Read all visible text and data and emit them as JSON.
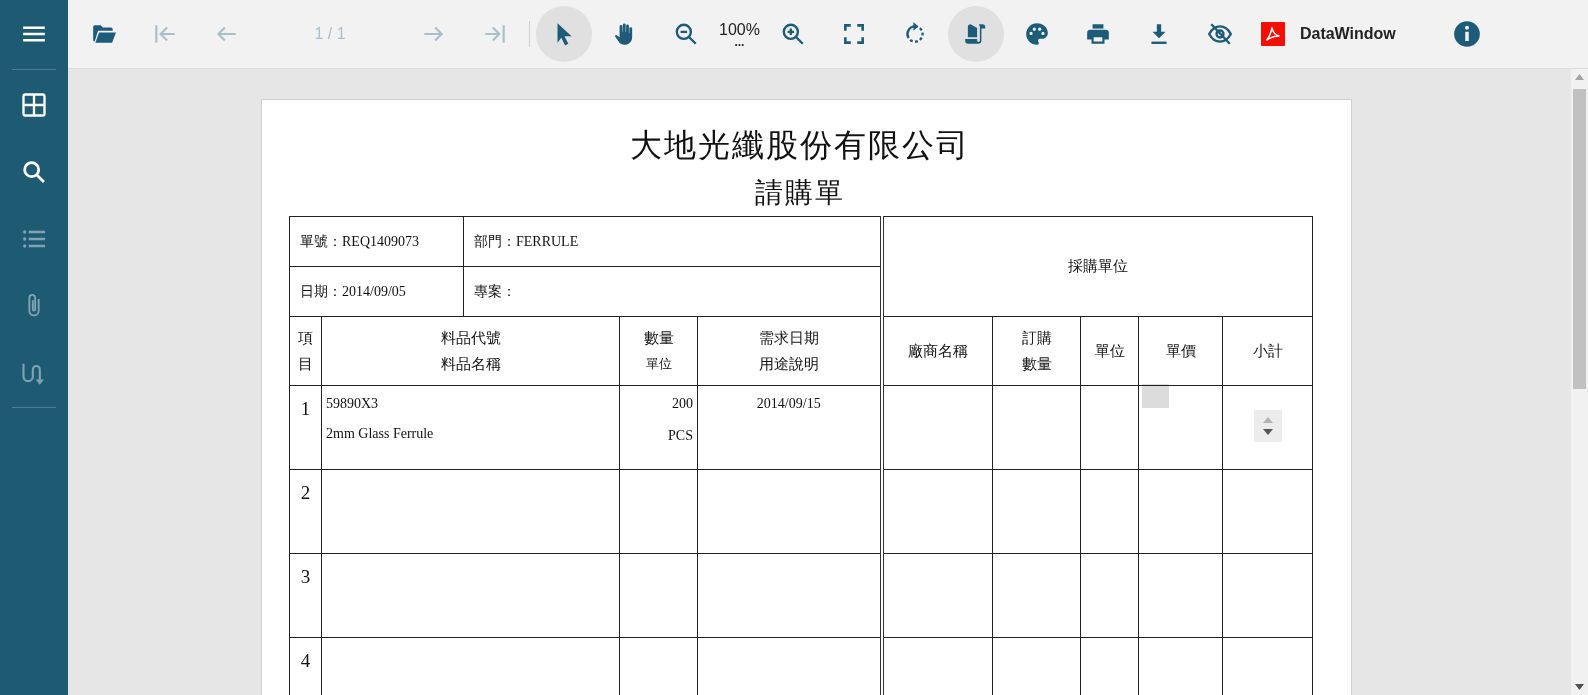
{
  "sidebar": {
    "items": [
      {
        "kind": "menu",
        "disabled": false
      },
      {
        "kind": "thumbnails",
        "disabled": false
      },
      {
        "kind": "search",
        "disabled": false
      },
      {
        "kind": "outline",
        "disabled": true
      },
      {
        "kind": "attachments",
        "disabled": true
      },
      {
        "kind": "ribbon",
        "disabled": true
      }
    ]
  },
  "toolbar": {
    "items": [
      {
        "kind": "open",
        "disabled": false,
        "selected": false
      },
      {
        "kind": "first",
        "disabled": true,
        "selected": false
      },
      {
        "kind": "prev",
        "disabled": true,
        "selected": false
      },
      {
        "kind": "page",
        "text": "1 / 1",
        "disabled": true,
        "selected": false
      },
      {
        "kind": "next",
        "disabled": true,
        "selected": false
      },
      {
        "kind": "last",
        "disabled": true,
        "selected": false
      },
      {
        "kind": "divider"
      },
      {
        "kind": "select",
        "disabled": false,
        "selected": true
      },
      {
        "kind": "pan",
        "disabled": false,
        "selected": false
      },
      {
        "kind": "zoomout",
        "disabled": false,
        "selected": false
      },
      {
        "kind": "zoom",
        "text": "100%",
        "more": "...",
        "disabled": false,
        "selected": false
      },
      {
        "kind": "zoomin",
        "disabled": false,
        "selected": false
      },
      {
        "kind": "fit",
        "disabled": false,
        "selected": false
      },
      {
        "kind": "rotate",
        "disabled": false,
        "selected": false
      },
      {
        "kind": "scroll",
        "disabled": false,
        "selected": true
      },
      {
        "kind": "theme",
        "disabled": false,
        "selected": false
      },
      {
        "kind": "print",
        "disabled": false,
        "selected": false
      },
      {
        "kind": "download",
        "disabled": false,
        "selected": false
      },
      {
        "kind": "hide",
        "disabled": false,
        "selected": false
      },
      {
        "kind": "pdf",
        "text": "DataWindow",
        "disabled": false,
        "selected": false
      },
      {
        "kind": "info",
        "disabled": false,
        "selected": false
      }
    ]
  },
  "document": {
    "title": "大地光纖股份有限公司",
    "subtitle": "請購單",
    "fields": [
      {
        "text": "單號：REQ1409073"
      },
      {
        "text": "部門：FERRULE"
      },
      {
        "text": "日期：2014/09/05"
      },
      {
        "text": "專案："
      }
    ],
    "purchasing_header": "採購單位",
    "columns": [
      {
        "kind": "vertical",
        "text": "項目"
      },
      {
        "kind": "stack",
        "lines": [
          "料品代號",
          "料品名稱"
        ]
      },
      {
        "kind": "stack",
        "lines": [
          "數量",
          "單位"
        ]
      },
      {
        "kind": "stack",
        "lines": [
          "需求日期",
          "用途說明"
        ]
      },
      {
        "kind": "single",
        "text": "廠商名稱"
      },
      {
        "kind": "stack",
        "lines": [
          "訂購",
          "數量"
        ]
      },
      {
        "kind": "single",
        "text": "單位"
      },
      {
        "kind": "single",
        "text": "單價"
      },
      {
        "kind": "single",
        "text": "小計"
      }
    ],
    "rows": [
      {
        "item": "1",
        "code": "59890X3",
        "name": "2mm Glass Ferrule",
        "quantity": "200",
        "unit": "PCS",
        "due_date": "2014/09/15",
        "price_field": true,
        "subtotal_spinner": true
      },
      {
        "item": "2"
      },
      {
        "item": "3"
      },
      {
        "item": "4"
      }
    ]
  }
}
